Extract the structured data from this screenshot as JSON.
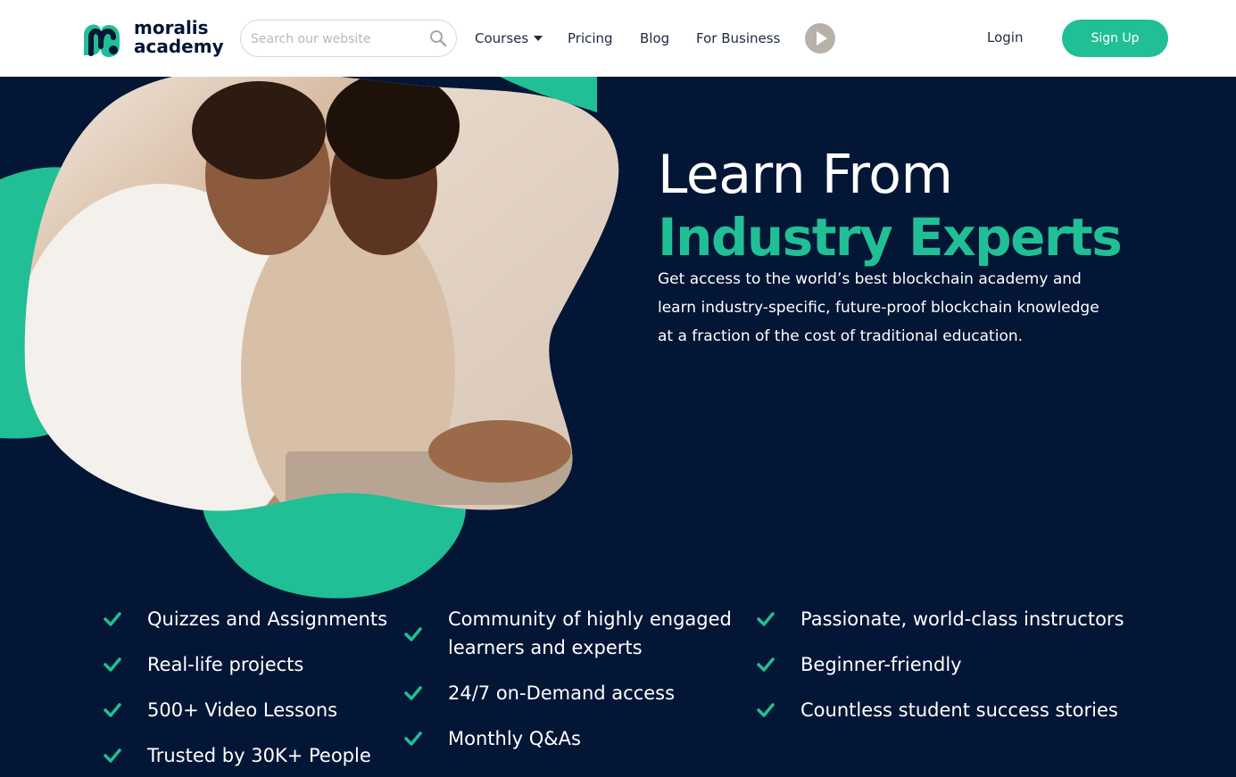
{
  "brand": {
    "line1": "moralis",
    "line2": "academy"
  },
  "search": {
    "placeholder": "Search our website"
  },
  "nav": {
    "courses": "Courses",
    "pricing": "Pricing",
    "blog": "Blog",
    "for_business": "For Business"
  },
  "auth": {
    "login": "Login",
    "signup": "Sign Up"
  },
  "hero": {
    "title_line1": "Learn From",
    "title_line2": "Industry Experts",
    "description": "Get access to the world’s best blockchain academy and learn industry-specific, future-proof blockchain knowledge at a fraction of the cost of traditional education."
  },
  "features": {
    "col1": [
      "Quizzes and Assignments",
      "Real-life projects",
      "500+ Video Lessons",
      "Trusted by 30K+ People"
    ],
    "col2": [
      "Community of highly engaged learners and experts",
      "24/7 on-Demand access",
      "Monthly Q&As"
    ],
    "col3": [
      "Passionate, world-class instructors",
      "Beginner-friendly",
      "Countless student success stories"
    ]
  },
  "colors": {
    "accent": "#21bf96",
    "background": "#031635",
    "header": "#ffffff"
  },
  "icons": [
    "logo-mark-icon",
    "search-icon",
    "caret-down-icon",
    "play-icon",
    "check-icon"
  ]
}
